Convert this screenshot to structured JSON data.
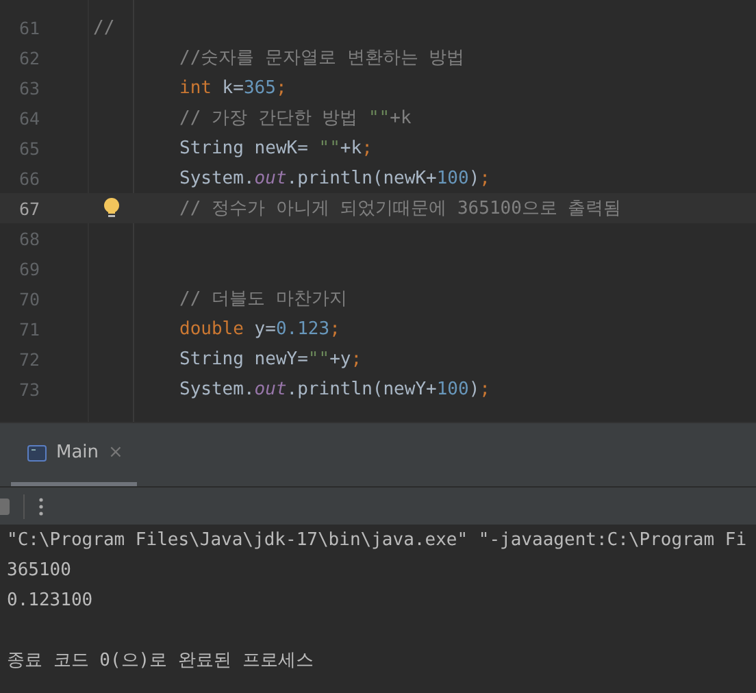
{
  "editor": {
    "lines": [
      {
        "number": "61",
        "current": false,
        "indented": false,
        "tokens": [
          {
            "kind": "comment",
            "text": "//"
          }
        ]
      },
      {
        "number": "62",
        "current": false,
        "indented": true,
        "tokens": [
          {
            "kind": "comment",
            "text": "//숫자를 문자열로 변환하는 방법"
          }
        ]
      },
      {
        "number": "63",
        "current": false,
        "indented": true,
        "tokens": [
          {
            "kind": "keyword",
            "text": "int"
          },
          {
            "kind": "plain",
            "text": " k="
          },
          {
            "kind": "number",
            "text": "365"
          },
          {
            "kind": "keyword",
            "text": ";"
          }
        ]
      },
      {
        "number": "64",
        "current": false,
        "indented": true,
        "tokens": [
          {
            "kind": "comment",
            "text": "// 가장 간단한 방법 "
          },
          {
            "kind": "string",
            "text": "\"\""
          },
          {
            "kind": "comment",
            "text": "+k"
          }
        ]
      },
      {
        "number": "65",
        "current": false,
        "indented": true,
        "tokens": [
          {
            "kind": "plain",
            "text": "String newK= "
          },
          {
            "kind": "string",
            "text": "\"\""
          },
          {
            "kind": "plain",
            "text": "+k"
          },
          {
            "kind": "keyword",
            "text": ";"
          }
        ]
      },
      {
        "number": "66",
        "current": false,
        "indented": true,
        "tokens": [
          {
            "kind": "plain",
            "text": "System."
          },
          {
            "kind": "field",
            "text": "out"
          },
          {
            "kind": "plain",
            "text": ".println(newK+"
          },
          {
            "kind": "number",
            "text": "100"
          },
          {
            "kind": "plain",
            "text": ")"
          },
          {
            "kind": "keyword",
            "text": ";"
          }
        ]
      },
      {
        "number": "67",
        "current": true,
        "intention": true,
        "indented": true,
        "tokens": [
          {
            "kind": "comment",
            "text": "// 정수가 아니게 되었기때문에 365100으로 출력됨"
          }
        ]
      },
      {
        "number": "68",
        "current": false
      },
      {
        "number": "69",
        "current": false
      },
      {
        "number": "70",
        "current": false,
        "indented": true,
        "tokens": [
          {
            "kind": "comment",
            "text": "// 더블도 마찬가지"
          }
        ]
      },
      {
        "number": "71",
        "current": false,
        "indented": true,
        "tokens": [
          {
            "kind": "keyword",
            "text": "double"
          },
          {
            "kind": "plain",
            "text": " y="
          },
          {
            "kind": "number",
            "text": "0.123"
          },
          {
            "kind": "keyword",
            "text": ";"
          }
        ]
      },
      {
        "number": "72",
        "current": false,
        "indented": true,
        "tokens": [
          {
            "kind": "plain",
            "text": "String newY="
          },
          {
            "kind": "string",
            "text": "\"\""
          },
          {
            "kind": "plain",
            "text": "+y"
          },
          {
            "kind": "keyword",
            "text": ";"
          }
        ]
      },
      {
        "number": "73",
        "current": false,
        "indented": true,
        "tokens": [
          {
            "kind": "plain",
            "text": "System."
          },
          {
            "kind": "field",
            "text": "out"
          },
          {
            "kind": "plain",
            "text": ".println(newY+"
          },
          {
            "kind": "number",
            "text": "100"
          },
          {
            "kind": "plain",
            "text": ")"
          },
          {
            "kind": "keyword",
            "text": ";"
          }
        ]
      }
    ]
  },
  "run_panel": {
    "tabs": [
      {
        "label": "Main",
        "selected": true,
        "close": "×"
      }
    ],
    "console": {
      "command": "\"C:\\Program Files\\Java\\jdk-17\\bin\\java.exe\" \"-javaagent:C:\\Program Fi",
      "output": [
        "365100",
        "0.123100"
      ],
      "exit_message": "종료 코드 0(으)로 완료된 프로세스"
    }
  }
}
